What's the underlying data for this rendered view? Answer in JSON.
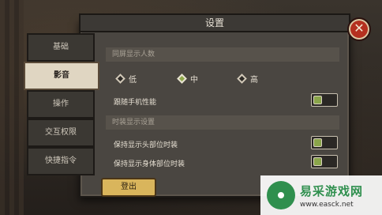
{
  "window": {
    "title": "设置"
  },
  "sidebar": {
    "items": [
      {
        "label": "基础",
        "active": false
      },
      {
        "label": "影音",
        "active": true
      },
      {
        "label": "操作",
        "active": false
      },
      {
        "label": "交互权限",
        "active": false
      },
      {
        "label": "快捷指令",
        "active": false
      }
    ]
  },
  "sections": {
    "players": {
      "header": "同屏显示人数",
      "options": [
        {
          "label": "低",
          "checked": false
        },
        {
          "label": "中",
          "checked": true
        },
        {
          "label": "高",
          "checked": false
        }
      ],
      "follow_label": "跟随手机性能",
      "follow_on": true
    },
    "outfit": {
      "header": "时装显示设置",
      "head_label": "保持显示头部位时装",
      "head_on": true,
      "body_label": "保持显示身体部位时装",
      "body_on": true
    }
  },
  "footer": {
    "logout_label": "登出"
  },
  "watermark": {
    "brand": "易采游戏网",
    "url": "www.easck.net"
  },
  "colors": {
    "accent_green": "#8aa54a",
    "close_red": "#b5301f",
    "logout_gold": "#d9b55c"
  }
}
